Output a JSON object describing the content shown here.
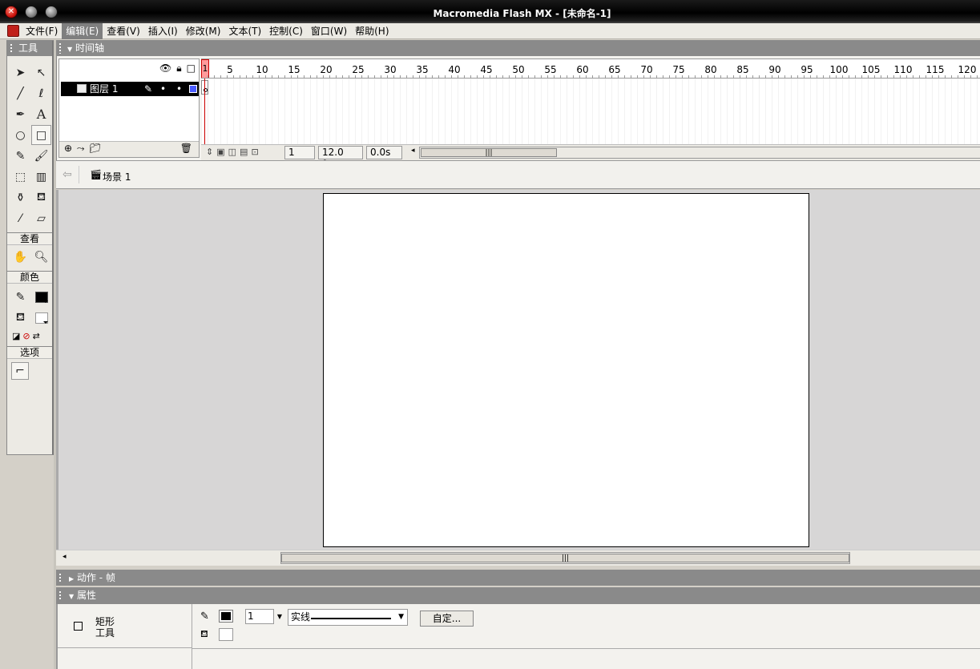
{
  "window": {
    "title": "Macromedia Flash MX - [未命名-1]"
  },
  "menu": [
    "文件(F)",
    "编辑(E)",
    "查看(V)",
    "插入(I)",
    "修改(M)",
    "文本(T)",
    "控制(C)",
    "窗口(W)",
    "帮助(H)"
  ],
  "menu_active_index": 1,
  "tools": {
    "title": "工具",
    "view_title": "查看",
    "color_title": "颜色",
    "options_title": "选项"
  },
  "timeline": {
    "title": "时间轴",
    "layer_name": "图层 1",
    "ruler_marks": [
      "1",
      "5",
      "10",
      "15",
      "20",
      "25",
      "30",
      "35",
      "40",
      "45",
      "50",
      "55",
      "60",
      "65",
      "70",
      "75",
      "80",
      "85",
      "90",
      "95",
      "100",
      "105",
      "110",
      "115",
      "120"
    ],
    "current_frame": "1",
    "fps": "12.0 fps",
    "time": "0.0s"
  },
  "editbar": {
    "scene": "场景 1"
  },
  "panels": {
    "actions_title": "动作 - 帧",
    "properties_title": "属性"
  },
  "properties": {
    "tool_name": "矩形\n工具",
    "stroke_width": "1",
    "stroke_style": "实线",
    "custom_button": "自定..."
  },
  "colors": {
    "accent_red": "#c0201a",
    "layer_selected": "#000000",
    "layer_color": "#4a5cff",
    "stage": "#ffffff",
    "workspace": "#d7d6d6"
  }
}
